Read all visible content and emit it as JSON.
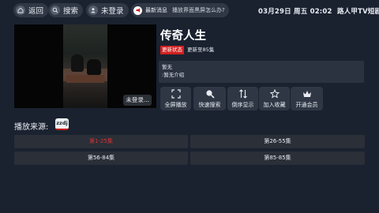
{
  "topbar": {
    "back_label": "返回",
    "search_label": "搜索",
    "login_label": "未登录",
    "news_tag": "最新消息",
    "news_message": "播放界面黑屏怎么办?",
    "clock": "03月29日 周五 02:02",
    "app_name": "路人甲TV短剧"
  },
  "player": {
    "login_hint": "未登录..."
  },
  "detail": {
    "title": "传奇人生",
    "status_badge": "更新状态",
    "updated_text": "更新至85集",
    "desc_line1": "暂无",
    "desc_line2": ":暂无介绍"
  },
  "actions": [
    {
      "label": "全屏播放",
      "icon": "fullscreen-icon"
    },
    {
      "label": "快速搜索",
      "icon": "search-icon"
    },
    {
      "label": "倒序显示",
      "icon": "sort-icon"
    },
    {
      "label": "加入收藏",
      "icon": "star-icon"
    },
    {
      "label": "开通会员",
      "icon": "vip-icon"
    }
  ],
  "source": {
    "label": "播放来源:",
    "selected": "zzdj"
  },
  "episodes": [
    {
      "label": "第1-25集",
      "active": true
    },
    {
      "label": "第26-55集",
      "active": false
    },
    {
      "label": "第56-84集",
      "active": false
    },
    {
      "label": "第85-85集",
      "active": false
    }
  ],
  "colors": {
    "background": "#1a2230",
    "accent_red": "#d11f1f",
    "panel": "#2b3340"
  }
}
